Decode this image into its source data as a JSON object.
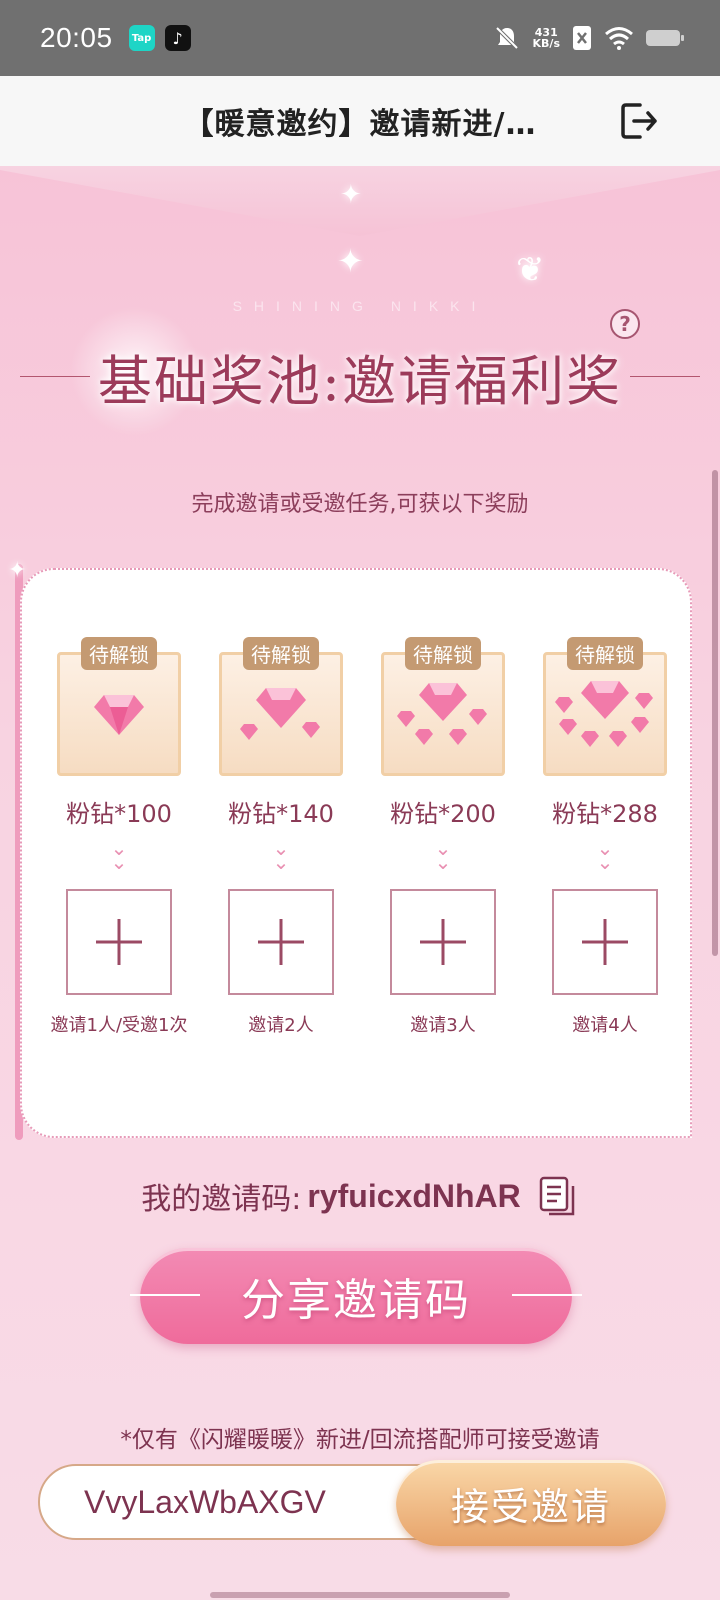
{
  "status_bar": {
    "time": "20:05",
    "app_badges": [
      "Tap",
      "♪"
    ],
    "net_speed_value": "431",
    "net_speed_unit": "KB/s"
  },
  "header": {
    "title": "【暖意邀约】邀请新进/…",
    "exit_icon": "logout-icon"
  },
  "hero": {
    "brand": "SHINING NIKKI",
    "title": "基础奖池:邀请福利奖",
    "help_symbol": "?"
  },
  "subtitle": "完成邀请或受邀任务,可获以下奖励",
  "rewards": [
    {
      "lock": "待解锁",
      "label": "粉钻*100",
      "requirement": "邀请1人/受邀1次"
    },
    {
      "lock": "待解锁",
      "label": "粉钻*140",
      "requirement": "邀请2人"
    },
    {
      "lock": "待解锁",
      "label": "粉钻*200",
      "requirement": "邀请3人"
    },
    {
      "lock": "待解锁",
      "label": "粉钻*288",
      "requirement": "邀请4人"
    }
  ],
  "my_code": {
    "label": "我的邀请码:",
    "value": "ryfuicxdNhAR"
  },
  "share_button": "分享邀请码",
  "note": "*仅有《闪耀暖暖》新进/回流搭配师可接受邀请",
  "accept": {
    "input_value": "VvyLaxWbAXGV",
    "button": "接受邀请"
  },
  "colors": {
    "accent": "#ef6b9b",
    "text": "#7d3350",
    "gold": "#e7a36a"
  }
}
